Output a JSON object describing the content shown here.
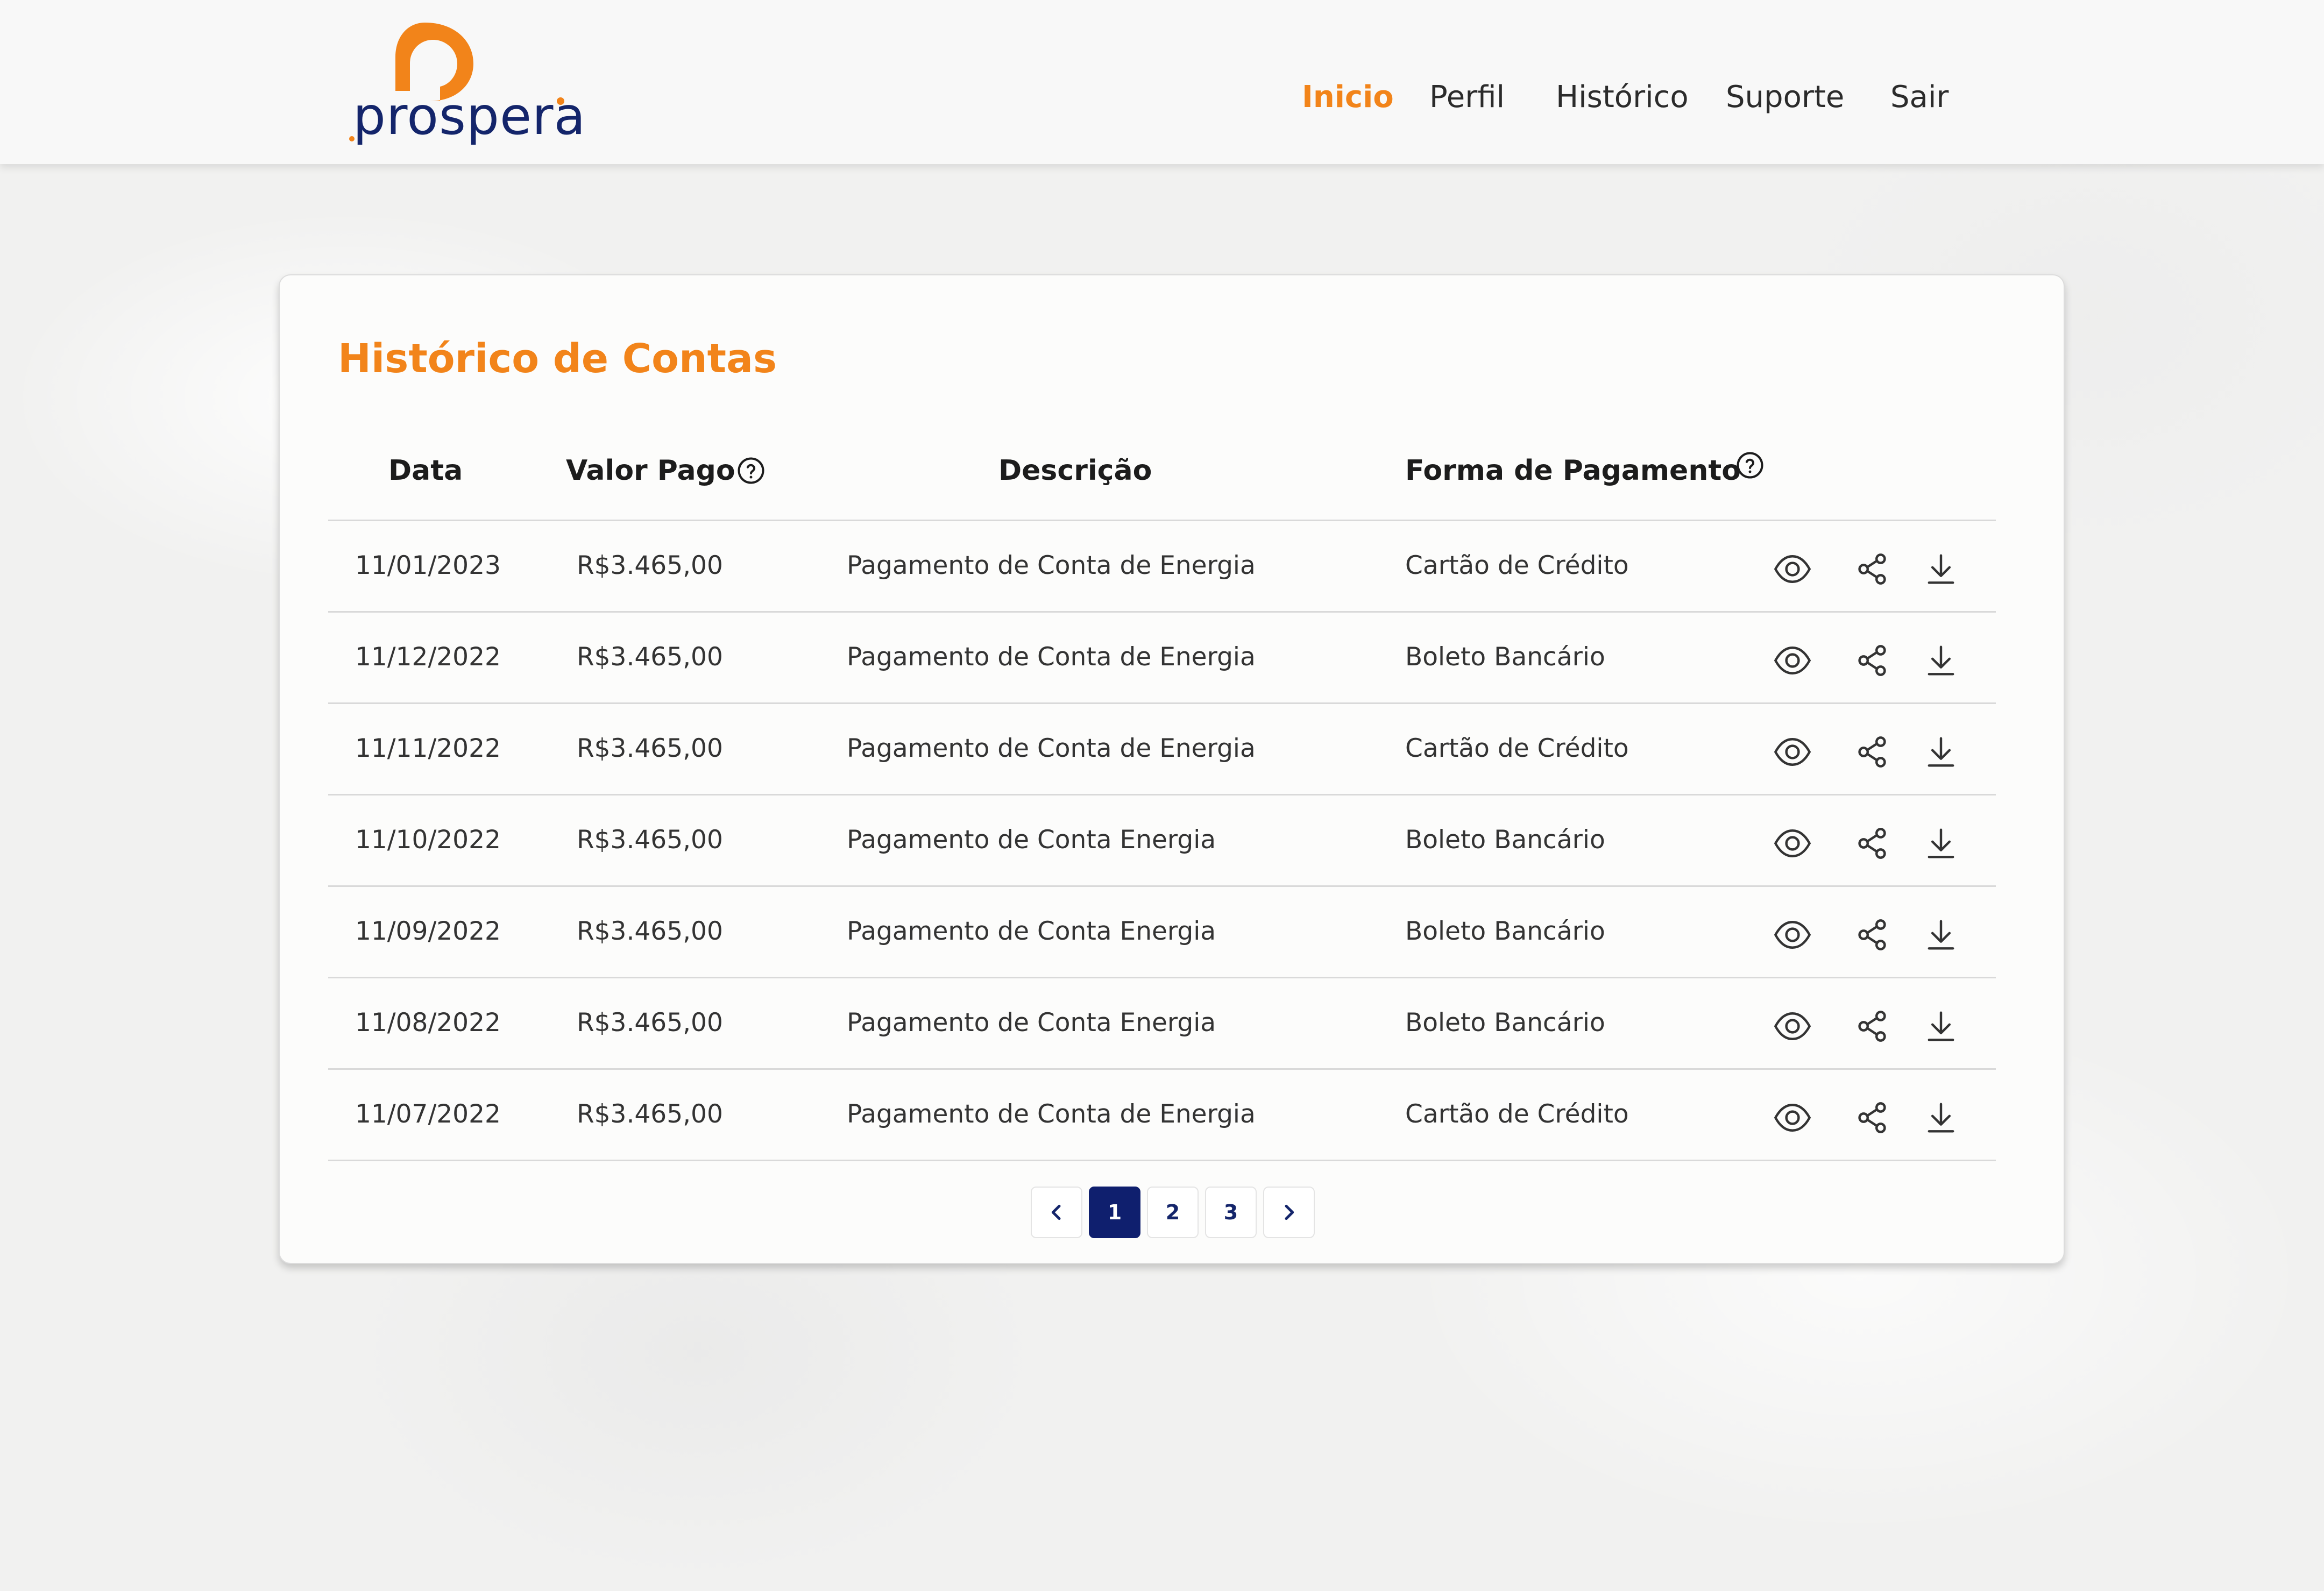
{
  "header": {
    "logo_text": "prospera",
    "nav": [
      {
        "label": "Inicio",
        "active": true
      },
      {
        "label": "Perfil",
        "active": false
      },
      {
        "label": "Histórico",
        "active": false
      },
      {
        "label": "Suporte",
        "active": false
      },
      {
        "label": "Sair",
        "active": false
      }
    ]
  },
  "card": {
    "title": "Histórico de Contas",
    "columns": {
      "date": "Data",
      "amount": "Valor Pago",
      "description": "Descrição",
      "payment": "Forma de Pagamento"
    },
    "rows": [
      {
        "date": "11/01/2023",
        "amount": "R$3.465,00",
        "description": "Pagamento de Conta de Energia",
        "payment": "Cartão de Crédito"
      },
      {
        "date": "11/12/2022",
        "amount": "R$3.465,00",
        "description": "Pagamento de Conta de Energia",
        "payment": "Boleto Bancário"
      },
      {
        "date": "11/11/2022",
        "amount": "R$3.465,00",
        "description": "Pagamento de Conta de Energia",
        "payment": "Cartão de Crédito"
      },
      {
        "date": "11/10/2022",
        "amount": "R$3.465,00",
        "description": "Pagamento de Conta Energia",
        "payment": "Boleto Bancário"
      },
      {
        "date": "11/09/2022",
        "amount": "R$3.465,00",
        "description": "Pagamento de Conta Energia",
        "payment": "Boleto Bancário"
      },
      {
        "date": "11/08/2022",
        "amount": "R$3.465,00",
        "description": "Pagamento de Conta Energia",
        "payment": "Boleto Bancário"
      },
      {
        "date": "11/07/2022",
        "amount": "R$3.465,00",
        "description": "Pagamento de Conta de Energia",
        "payment": "Cartão de Crédito"
      }
    ],
    "row_icons": [
      "eye-icon",
      "share-icon",
      "download-icon"
    ],
    "pagination": {
      "prev_icon": "chevron-left-icon",
      "next_icon": "chevron-right-icon",
      "pages": [
        "1",
        "2",
        "3"
      ],
      "current": "1"
    }
  },
  "colors": {
    "accent": "#f2841a",
    "brand_navy": "#14256b",
    "active_page": "#0f1f6e"
  }
}
